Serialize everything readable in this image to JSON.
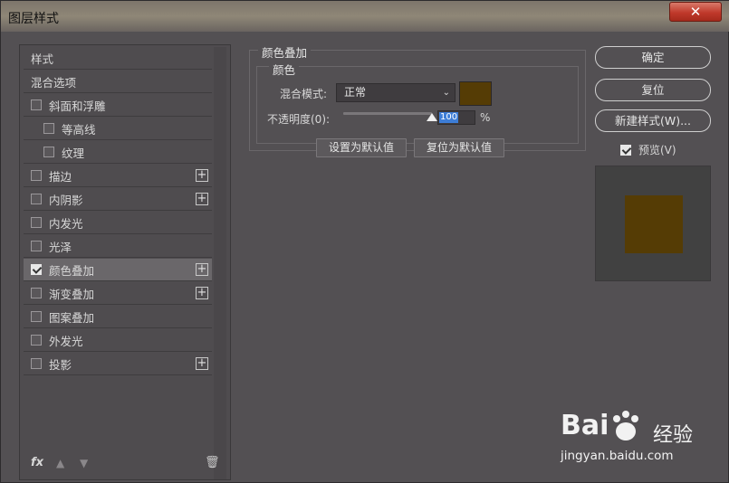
{
  "window": {
    "title": "图层样式",
    "close_glyph": "✕"
  },
  "style_list": {
    "items": [
      {
        "label": "样式",
        "checkbox": false,
        "checked": false,
        "indent": 0,
        "plus": false,
        "selected": false
      },
      {
        "label": "混合选项",
        "checkbox": false,
        "checked": false,
        "indent": 0,
        "plus": false,
        "selected": false
      },
      {
        "label": "斜面和浮雕",
        "checkbox": true,
        "checked": false,
        "indent": 0,
        "plus": false,
        "selected": false
      },
      {
        "label": "等高线",
        "checkbox": true,
        "checked": false,
        "indent": 1,
        "plus": false,
        "selected": false
      },
      {
        "label": "纹理",
        "checkbox": true,
        "checked": false,
        "indent": 1,
        "plus": false,
        "selected": false
      },
      {
        "label": "描边",
        "checkbox": true,
        "checked": false,
        "indent": 0,
        "plus": true,
        "selected": false
      },
      {
        "label": "内阴影",
        "checkbox": true,
        "checked": false,
        "indent": 0,
        "plus": true,
        "selected": false
      },
      {
        "label": "内发光",
        "checkbox": true,
        "checked": false,
        "indent": 0,
        "plus": false,
        "selected": false
      },
      {
        "label": "光泽",
        "checkbox": true,
        "checked": false,
        "indent": 0,
        "plus": false,
        "selected": false
      },
      {
        "label": "颜色叠加",
        "checkbox": true,
        "checked": true,
        "indent": 0,
        "plus": true,
        "selected": true
      },
      {
        "label": "渐变叠加",
        "checkbox": true,
        "checked": false,
        "indent": 0,
        "plus": true,
        "selected": false
      },
      {
        "label": "图案叠加",
        "checkbox": true,
        "checked": false,
        "indent": 0,
        "plus": false,
        "selected": false
      },
      {
        "label": "外发光",
        "checkbox": true,
        "checked": false,
        "indent": 0,
        "plus": false,
        "selected": false
      },
      {
        "label": "投影",
        "checkbox": true,
        "checked": false,
        "indent": 0,
        "plus": true,
        "selected": false
      }
    ],
    "plus_glyph": "+",
    "footer": {
      "fx_label": "fx",
      "up_glyph": "▲",
      "down_glyph": "▼",
      "trash_glyph": "🗑"
    }
  },
  "panel": {
    "section_title": "颜色叠加",
    "subsection_title": "颜色",
    "blend_mode_label": "混合模式:",
    "blend_mode_value": "正常",
    "overlay_color": "#553c05",
    "opacity_label": "不透明度(0):",
    "opacity_value": "100",
    "opacity_unit": "%",
    "opacity_percent": 100,
    "set_default_label": "设置为默认值",
    "reset_default_label": "复位为默认值"
  },
  "actions": {
    "ok_label": "确定",
    "reset_label": "复位",
    "new_style_label": "新建样式(W)...",
    "preview_label": "预览(V)",
    "preview_checked": true
  },
  "watermark": {
    "logo_text": "Bai",
    "cn_text": "经验",
    "url": "jingyan.baidu.com"
  }
}
